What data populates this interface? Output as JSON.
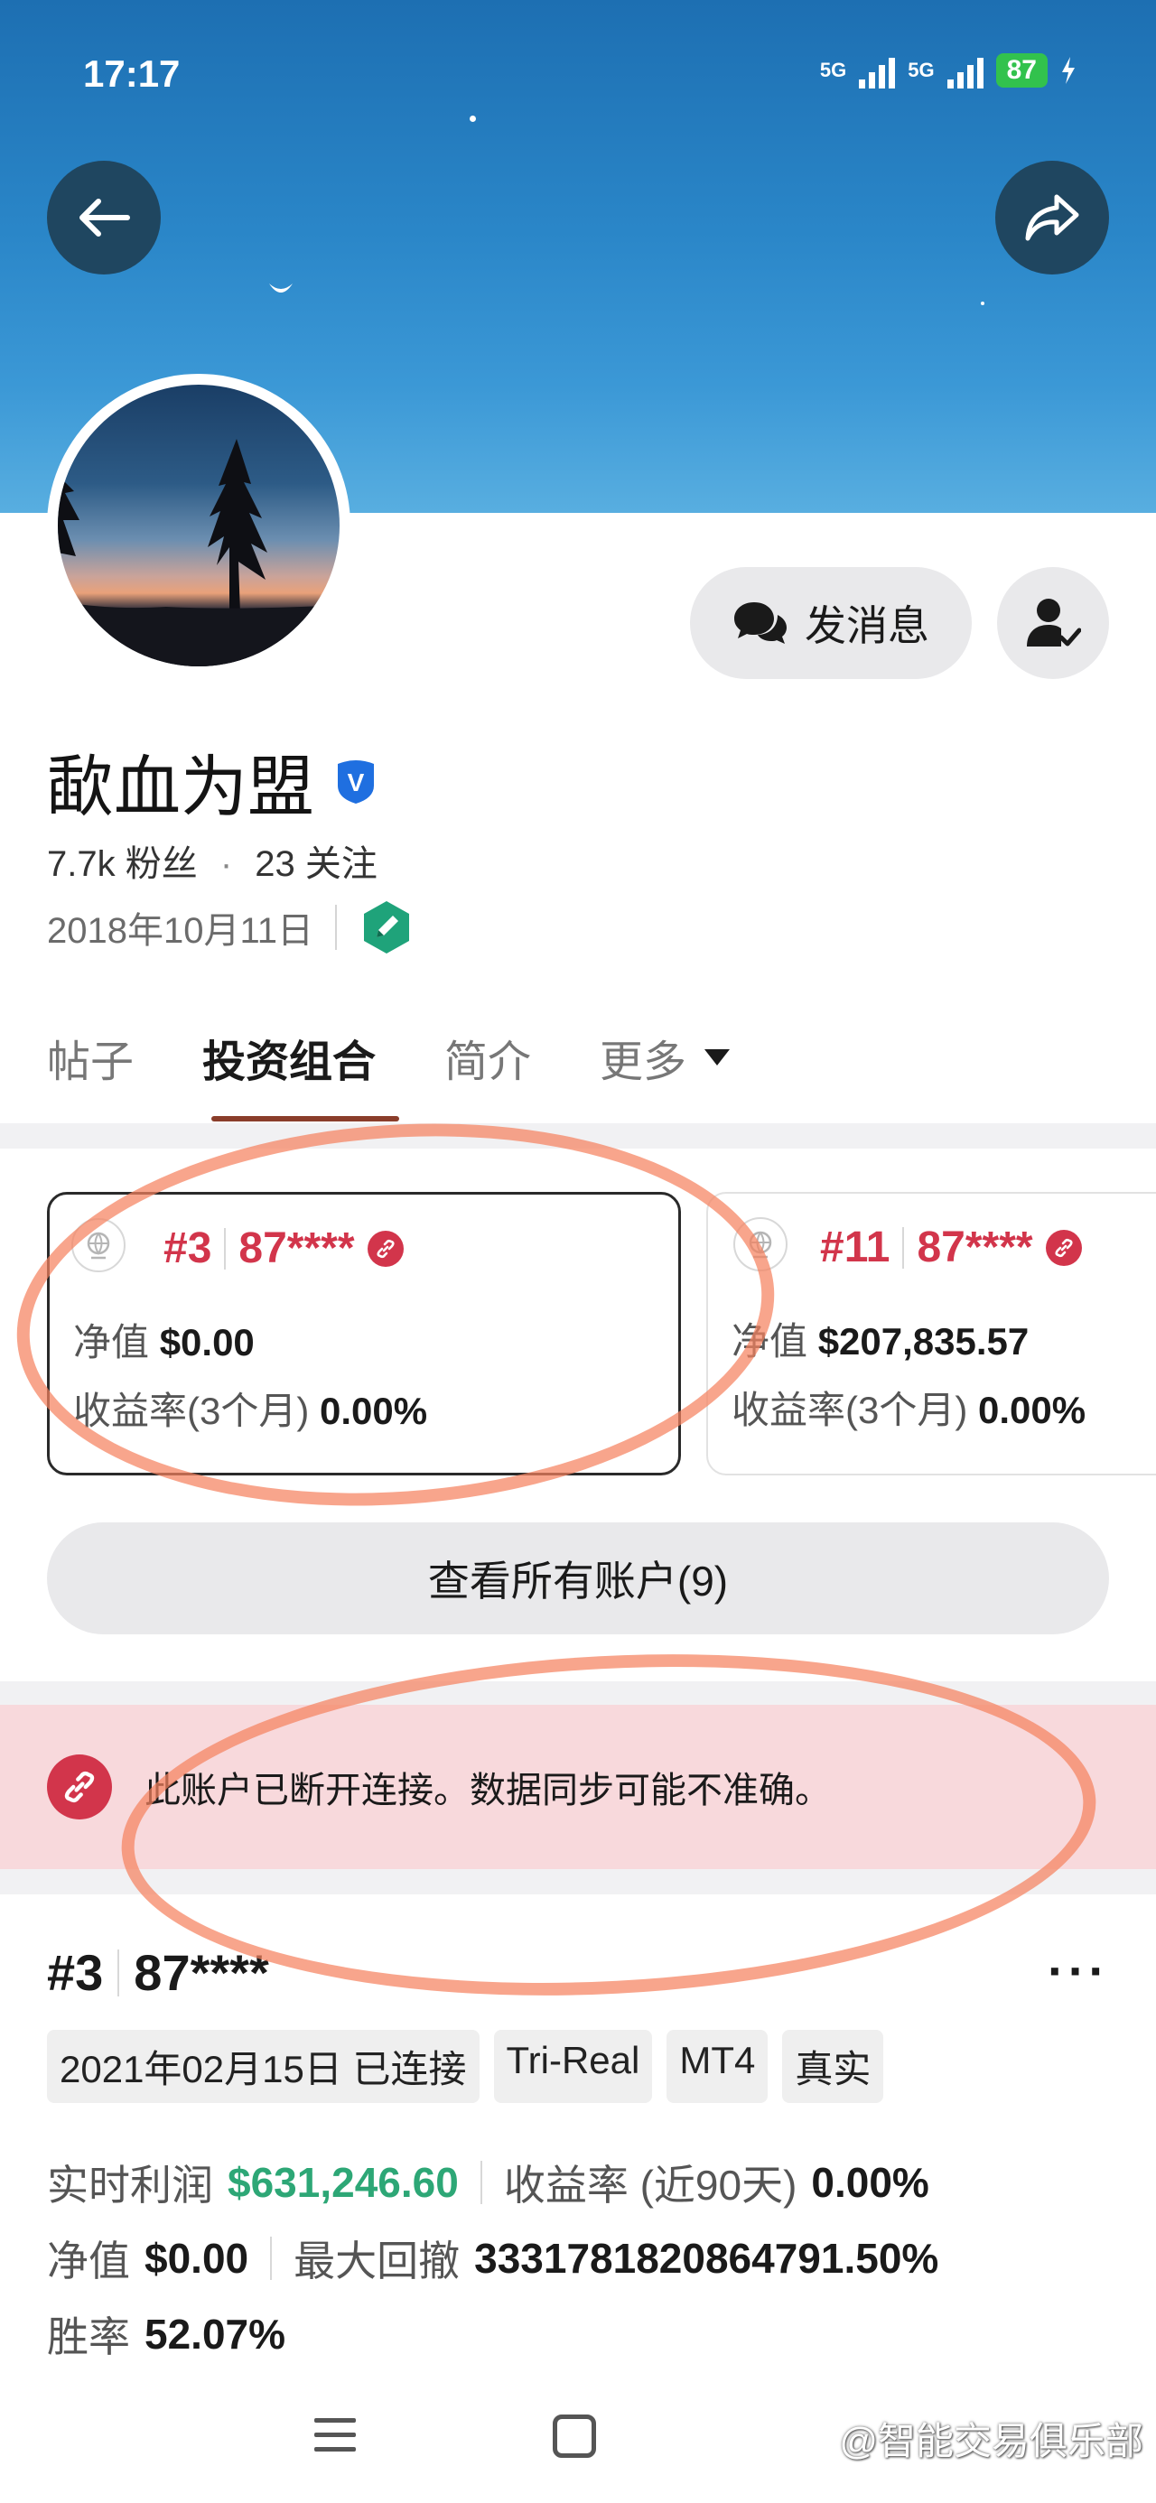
{
  "status_bar": {
    "time": "17:17",
    "network_1": "5G",
    "network_2": "5G",
    "battery": "87"
  },
  "profile": {
    "message_button": "发消息",
    "name": "歃血为盟",
    "verified_badge": "V",
    "followers": "7.7k 粉丝",
    "dot": "·",
    "following": "23 关注",
    "joined_date": "2018年10月11日"
  },
  "tabs": [
    {
      "label": "帖子"
    },
    {
      "label": "投资组合"
    },
    {
      "label": "简介"
    },
    {
      "label": "更多"
    }
  ],
  "accounts": [
    {
      "rank": "#3",
      "id": "87****",
      "equity_label": "净值",
      "equity": "$0.00",
      "return_label": "收益率(3个月)",
      "return": "0.00%"
    },
    {
      "rank": "#11",
      "id": "87****",
      "equity_label": "净值",
      "equity": "$207,835.57",
      "return_label": "收益率(3个月)",
      "return": "0.00%"
    }
  ],
  "view_all_button": "查看所有账户(9)",
  "alert": {
    "text": "此账户已断开连接。数据同步可能不准确。"
  },
  "account_detail": {
    "rank": "#3",
    "id": "87****",
    "more": "···",
    "chips": [
      "2021年02月15日 已连接",
      "Tri-Real",
      "MT4",
      "真实"
    ],
    "realtime_profit_label": "实时利润",
    "realtime_profit": "$631,246.60",
    "return_90_label": "收益率 (近90天)",
    "return_90": "0.00%",
    "equity_label": "净值",
    "equity": "$0.00",
    "max_drawdown_label": "最大回撤",
    "max_drawdown": "3331781820864791.50%",
    "win_rate_label": "胜率",
    "win_rate": "52.07%"
  },
  "watermark": "@智能交易俱乐部",
  "colors": {
    "accent_red": "#d2354b",
    "profit_green": "#2da776",
    "tab_underline": "#8a3d2a"
  }
}
